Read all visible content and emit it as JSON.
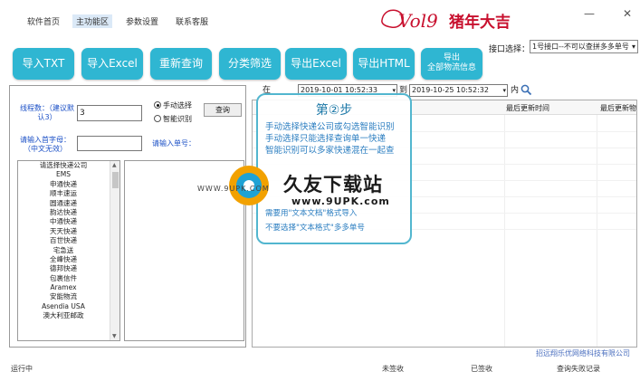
{
  "nav": {
    "items": [
      "软件首页",
      "主功能区",
      "参数设置",
      "联系客服"
    ],
    "active": "主功能区",
    "logo_text": "2019猪年大吉",
    "minimize": "—",
    "close": "✕"
  },
  "toolbar": {
    "buttons": [
      "导入TXT",
      "导入Excel",
      "重新查询",
      "分类筛选",
      "导出Excel",
      "导出HTML",
      "导出全部物流信息"
    ]
  },
  "interface": {
    "label": "接口选择：",
    "value": "1号接口--不可以查拼多多单号"
  },
  "left": {
    "thread_label": "线程数：（建议默认3）",
    "thread_value": "3",
    "radio_manual": "手动选择",
    "radio_smart": "智能识别",
    "query_button": "查询",
    "input_chinese_label": "请输入首字母：（中文无效）",
    "input_number_label": "请输入单号：",
    "courier_list": [
      "请选择快递公司",
      "EMS",
      "申通快递",
      "顺丰速运",
      "圆通速递",
      "韵达快递",
      "中通快递",
      "天天快递",
      "百世快递",
      "宅急送",
      "全峰快递",
      "德邦快递",
      "包裹信件",
      "Aramex",
      "安能物流",
      "Asendia USA",
      "澳大利亚邮政"
    ]
  },
  "dates": {
    "from_label": "在",
    "from_value": "2019-10-01 10:52:33",
    "to_label": "到",
    "to_value": "2019-10-25 10:52:32",
    "within_label": "内"
  },
  "grid": {
    "columns": [
      "最后更新时间",
      "最后更新物流"
    ]
  },
  "step": {
    "title": "第②步",
    "lines": [
      "手动选择快递公司或勾选智能识别",
      "手动选择只能选择查询单一快递",
      "智能识别可以多家快递混在一起查",
      "",
      "",
      "",
      "需要用\"文本文档\"格式导入",
      "不要选择\"文本格式\"多多单号"
    ]
  },
  "watermark": {
    "name": "久友下载站",
    "url": "www.9UPK.com",
    "prefix": "WWW.9UPK.COM"
  },
  "footer": {
    "company": "招远翔乐优网络科技有限公司",
    "status": "运行中",
    "unsigned": "未签收",
    "signed": "已签收",
    "failed": "查询失败记录"
  }
}
